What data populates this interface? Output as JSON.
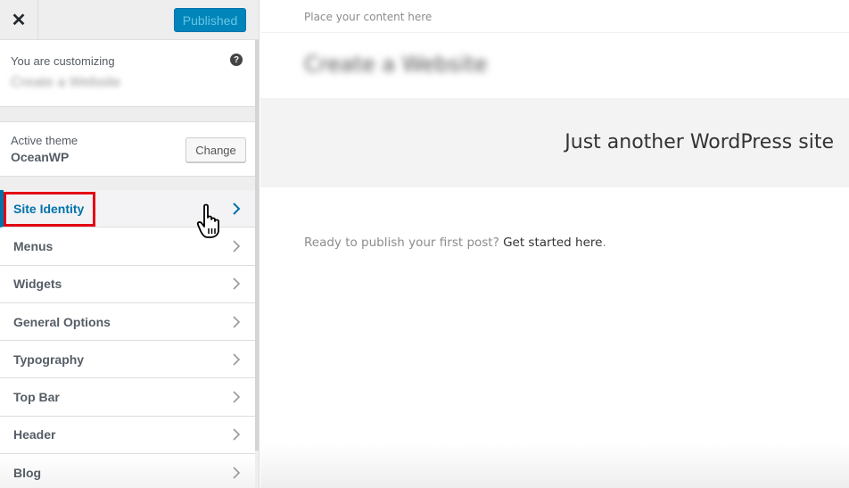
{
  "header": {
    "close_label": "✕",
    "publish_label": "Published"
  },
  "info": {
    "customizing_label": "You are customizing",
    "site_title": "Create a Website",
    "help_label": "?"
  },
  "theme": {
    "label": "Active theme",
    "name": "OceanWP",
    "change_label": "Change"
  },
  "nav": {
    "items": [
      {
        "label": "Site Identity",
        "active": true
      },
      {
        "label": "Menus"
      },
      {
        "label": "Widgets"
      },
      {
        "label": "General Options"
      },
      {
        "label": "Typography"
      },
      {
        "label": "Top Bar"
      },
      {
        "label": "Header"
      },
      {
        "label": "Blog"
      }
    ]
  },
  "preview": {
    "top_text": "Place your content here",
    "site_title": "Create a Website",
    "tagline": "Just another WordPress site",
    "ready_text": "Ready to publish your first post? ",
    "ready_link": "Get started here",
    "ready_end": "."
  },
  "colors": {
    "accent": "#0073aa",
    "publish_bg": "#0085ba",
    "highlight": "#e30613"
  }
}
